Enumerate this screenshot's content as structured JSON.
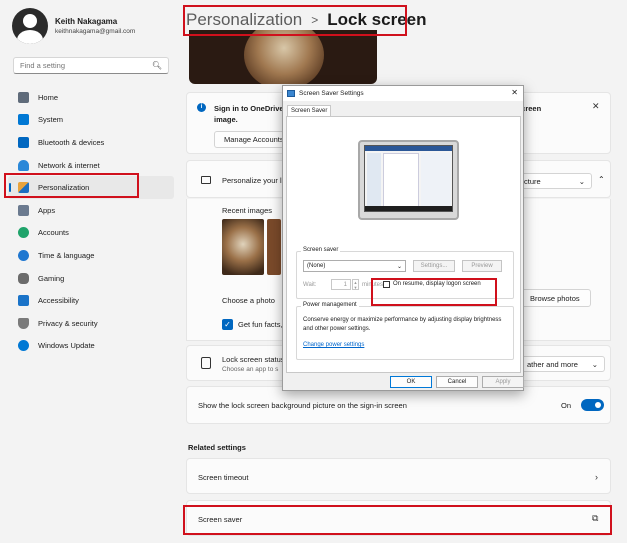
{
  "profile": {
    "name": "Keith Nakagama",
    "email": "keithnakagama@gmail.com"
  },
  "search": {
    "placeholder": "Find a setting",
    "icon": "search-icon"
  },
  "nav": {
    "items": [
      {
        "label": "Home",
        "icon": "home-icon",
        "color": "#5f6b7a"
      },
      {
        "label": "System",
        "icon": "monitor-icon",
        "color": "#0078d4"
      },
      {
        "label": "Bluetooth & devices",
        "icon": "bluetooth-icon",
        "color": "#0067c0"
      },
      {
        "label": "Network & internet",
        "icon": "wifi-icon",
        "color": "#2b88d8"
      },
      {
        "label": "Personalization",
        "icon": "brush-icon",
        "color": "#e8a33d"
      },
      {
        "label": "Apps",
        "icon": "apps-icon",
        "color": "#6b7a8f"
      },
      {
        "label": "Accounts",
        "icon": "accounts-icon",
        "color": "#1fa36a"
      },
      {
        "label": "Time & language",
        "icon": "globe-icon",
        "color": "#1f77d0"
      },
      {
        "label": "Gaming",
        "icon": "gamepad-icon",
        "color": "#6b6b6b"
      },
      {
        "label": "Accessibility",
        "icon": "accessibility-icon",
        "color": "#1a73c8"
      },
      {
        "label": "Privacy & security",
        "icon": "shield-icon",
        "color": "#7a7a7a"
      },
      {
        "label": "Windows Update",
        "icon": "update-icon",
        "color": "#0078d4"
      }
    ],
    "active_index": 4
  },
  "breadcrumb": {
    "parent": "Personalization",
    "separator": ">",
    "current": "Lock screen"
  },
  "signin_card": {
    "title": "Sign in to OneDrive",
    "title_line2": "image.",
    "title_right": "screen",
    "button": "Manage Accounts"
  },
  "personalize": {
    "label": "Personalize your l",
    "dropdown_value": "cture"
  },
  "recent": {
    "label": "Recent images",
    "choose_label": "Choose a photo",
    "browse_button": "Browse photos",
    "checkbox_label": "Get fun facts,"
  },
  "status": {
    "title": "Lock screen status",
    "subtitle": "Choose an app to s",
    "dropdown_value": "ather and more"
  },
  "bgpic": {
    "label": "Show the lock screen background picture on the sign-in screen",
    "state": "On"
  },
  "related": {
    "heading": "Related settings",
    "timeout": "Screen timeout",
    "saver": "Screen saver"
  },
  "dialog": {
    "title": "Screen Saver Settings",
    "tab": "Screen Saver",
    "saver_group": "Screen saver",
    "saver_value": "(None)",
    "settings_button": "Settings...",
    "preview_button": "Preview",
    "wait_label": "Wait:",
    "wait_value": "1",
    "minutes_label": "minutes",
    "resume_label": "On resume, display logon screen",
    "power_group": "Power management",
    "power_text": "Conserve energy or maximize performance by adjusting display brightness and other power settings.",
    "power_link": "Change power settings",
    "ok": "OK",
    "cancel": "Cancel",
    "apply": "Apply"
  },
  "colors": {
    "accent": "#0067c0",
    "highlight": "#d0101c"
  }
}
